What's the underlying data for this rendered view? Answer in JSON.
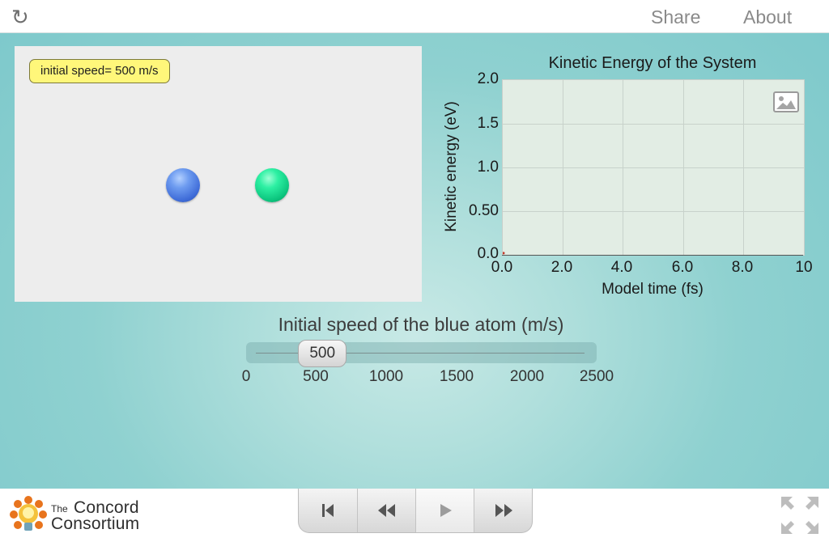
{
  "topbar": {
    "reload_icon": "reload-icon",
    "share_label": "Share",
    "about_label": "About"
  },
  "model": {
    "speed_badge": "initial speed= 500 m/s",
    "atoms": [
      {
        "name": "blue-atom",
        "color": "#4a78e0"
      },
      {
        "name": "green-atom",
        "color": "#13d88f"
      }
    ]
  },
  "chart_data": {
    "type": "line",
    "title": "Kinetic Energy of the System",
    "xlabel": "Model time (fs)",
    "ylabel": "Kinetic energy (eV)",
    "xlim": [
      0,
      10
    ],
    "ylim": [
      0,
      2.0
    ],
    "x_ticks": [
      "0.0",
      "2.0",
      "4.0",
      "6.0",
      "8.0",
      "10"
    ],
    "y_ticks": [
      "0.0",
      "0.50",
      "1.0",
      "1.5",
      "2.0"
    ],
    "grid": true,
    "series": [
      {
        "color": "#c0392b",
        "x": [
          0
        ],
        "y": [
          0.02
        ]
      }
    ]
  },
  "slider": {
    "title": "Initial speed of the blue atom (m/s)",
    "value": 500,
    "value_label": "500",
    "min": 0,
    "max": 2500,
    "ticks": [
      "0",
      "500",
      "1000",
      "1500",
      "2000",
      "2500"
    ]
  },
  "footer": {
    "logo_the": "The",
    "logo_concord": "Concord",
    "logo_consortium": "Consortium",
    "playback_buttons": [
      "reset-to-start",
      "step-back",
      "play",
      "step-forward"
    ]
  },
  "colors": {
    "accent_teal": "#8fd1d0",
    "badge_yellow": "#fff77a"
  }
}
